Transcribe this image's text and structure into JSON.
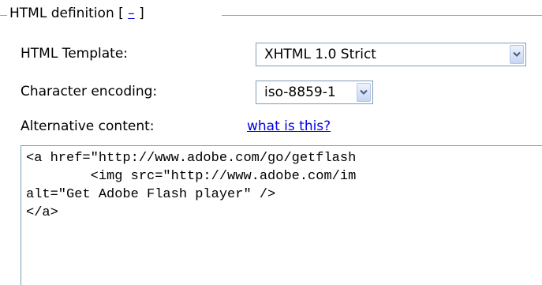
{
  "section": {
    "title_prefix": "HTML definition [",
    "toggle_link": "–",
    "title_suffix": "]"
  },
  "fields": {
    "html_template": {
      "label": "HTML Template:",
      "value": "XHTML 1.0 Strict"
    },
    "character_encoding": {
      "label": "Character encoding:",
      "value": "iso-8859-1"
    },
    "alternative_content": {
      "label": "Alternative content:",
      "help_link": "what is this?",
      "lines": [
        "<a href=\"http://www.adobe.com/go/getflash",
        "        <img src=\"http://www.adobe.com/im",
        "alt=\"Get Adobe Flash player\" />",
        "</a>"
      ]
    }
  },
  "colors": {
    "link": "#0000ee",
    "input_border": "#7f9db9",
    "arrow_glyph": "#4d6185"
  }
}
